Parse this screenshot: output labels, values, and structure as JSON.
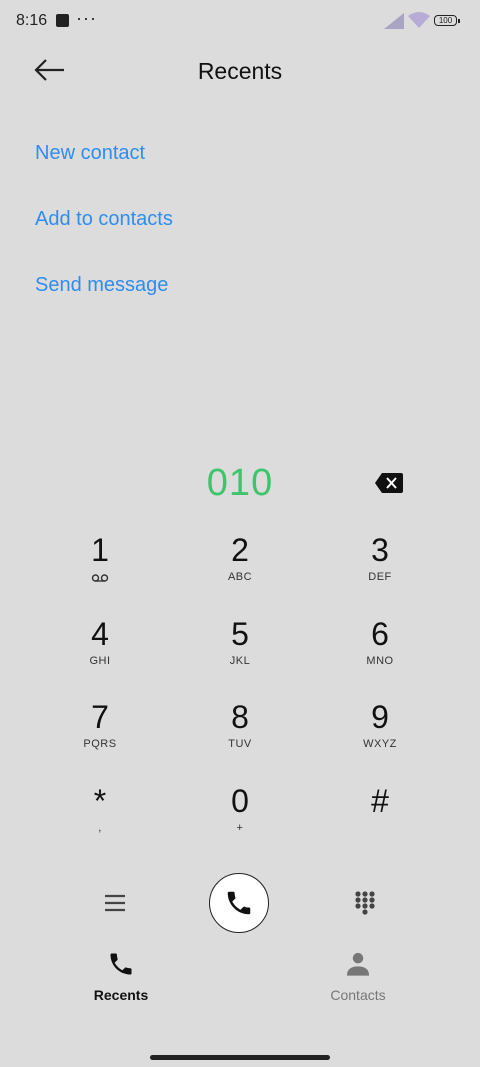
{
  "status_bar": {
    "time": "8:16",
    "battery": "100"
  },
  "header": {
    "title": "Recents"
  },
  "actions": [
    {
      "label": "New contact"
    },
    {
      "label": "Add to contacts"
    },
    {
      "label": "Send message"
    }
  ],
  "dialer": {
    "number": "010"
  },
  "keypad": [
    {
      "digit": "1",
      "letters": ""
    },
    {
      "digit": "2",
      "letters": "ABC"
    },
    {
      "digit": "3",
      "letters": "DEF"
    },
    {
      "digit": "4",
      "letters": "GHI"
    },
    {
      "digit": "5",
      "letters": "JKL"
    },
    {
      "digit": "6",
      "letters": "MNO"
    },
    {
      "digit": "7",
      "letters": "PQRS"
    },
    {
      "digit": "8",
      "letters": "TUV"
    },
    {
      "digit": "9",
      "letters": "WXYZ"
    },
    {
      "digit": "*",
      "letters": ","
    },
    {
      "digit": "0",
      "letters": "+"
    },
    {
      "digit": "#",
      "letters": ""
    }
  ],
  "tabs": [
    {
      "label": "Recents",
      "icon": "phone-icon",
      "active": true
    },
    {
      "label": "Contacts",
      "icon": "person-icon",
      "active": false
    }
  ],
  "colors": {
    "accent_link": "#2f8cf0",
    "number": "#3ec46a",
    "background": "#dcdcdc"
  }
}
